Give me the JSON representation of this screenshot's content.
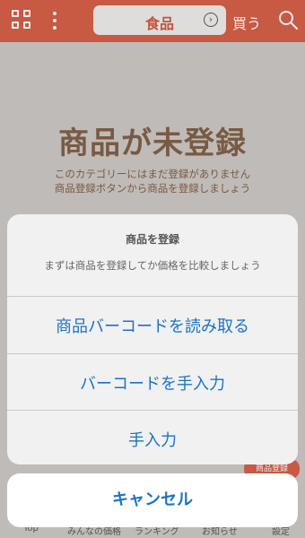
{
  "header": {
    "category_label": "食品",
    "buy_label": "買う",
    "icons": {
      "menu": "grid-icon",
      "more": "more-vertical-icon",
      "chevron": "chevron-right-icon",
      "search": "search-icon"
    }
  },
  "empty_state": {
    "title": "商品が未登録",
    "line1": "このカテゴリーにはまだ登録がありません",
    "line2": "商品登録ボタンから商品を登録しましょう"
  },
  "register_badge": "商品登録",
  "tabbar": {
    "items": [
      "Top",
      "みんなの価格",
      "ランキング",
      "お知らせ",
      "設定"
    ]
  },
  "action_sheet": {
    "title": "商品を登録",
    "message": "まずは商品を登録してか価格を比較しましょう",
    "options": [
      "商品バーコードを読み取る",
      "バーコードを手入力",
      "手入力"
    ],
    "cancel": "キャンセル"
  },
  "colors": {
    "accent": "#d95d45",
    "action_blue": "#1a73c8",
    "brown_text": "#7f5e45"
  }
}
